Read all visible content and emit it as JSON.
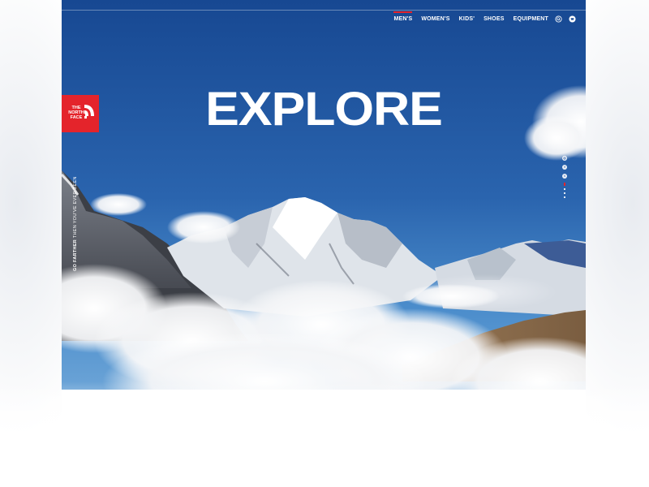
{
  "header": {
    "nav": [
      {
        "label": "MEN'S",
        "active": true
      },
      {
        "label": "WOMEN'S",
        "active": false
      },
      {
        "label": "KIDS'",
        "active": false
      },
      {
        "label": "SHOES",
        "active": false
      },
      {
        "label": "EQUIPMENT",
        "active": false
      }
    ],
    "icons": [
      "search-icon",
      "cart-icon"
    ]
  },
  "hero": {
    "headline": "EXPLORE"
  },
  "brand": {
    "logo_lines": [
      "THE",
      "NORTH",
      "FACE"
    ],
    "color": "#e4242b"
  },
  "tagline": {
    "bold": "GO FARTHER",
    "rest": " THEN YOU'VE EVER BEEN"
  },
  "social": [
    {
      "icon": "instagram-icon",
      "glyph": "◎"
    },
    {
      "icon": "facebook-icon",
      "glyph": "f"
    },
    {
      "icon": "twitter-icon",
      "glyph": "t"
    }
  ],
  "colors": {
    "sky_top": "#1a4a92",
    "sky_bottom": "#3c7fc3",
    "accent": "#e4242b"
  }
}
